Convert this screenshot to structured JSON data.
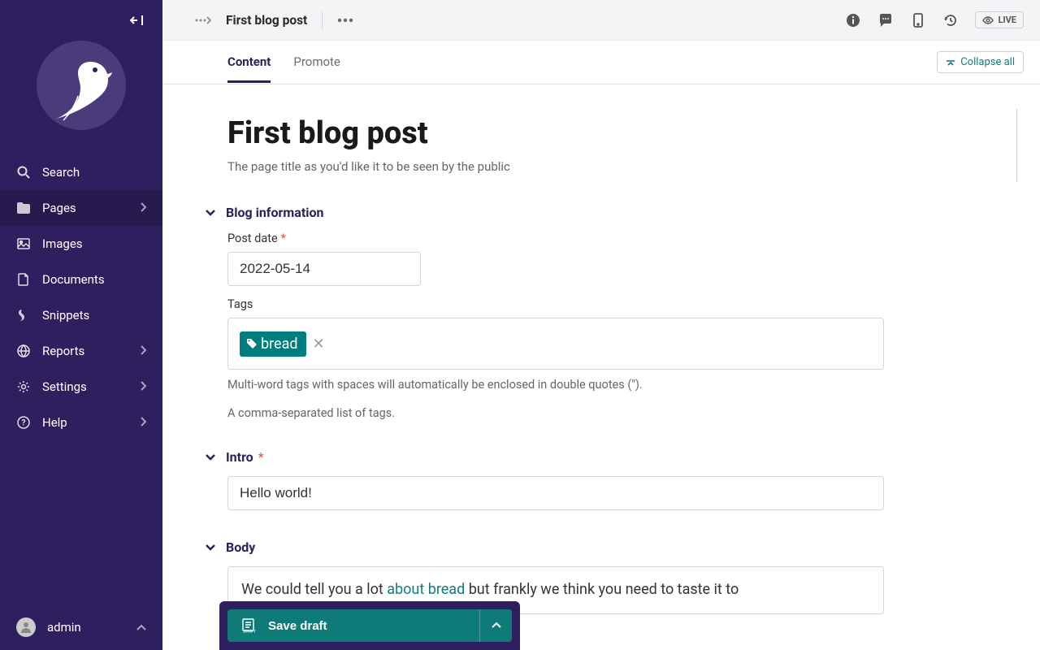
{
  "sidebar": {
    "items": [
      {
        "label": "Search",
        "icon": "search-icon",
        "expandable": false
      },
      {
        "label": "Pages",
        "icon": "folder-icon",
        "expandable": true,
        "active": true
      },
      {
        "label": "Images",
        "icon": "image-icon",
        "expandable": false
      },
      {
        "label": "Documents",
        "icon": "document-icon",
        "expandable": false
      },
      {
        "label": "Snippets",
        "icon": "snippet-icon",
        "expandable": false
      },
      {
        "label": "Reports",
        "icon": "globe-icon",
        "expandable": true
      },
      {
        "label": "Settings",
        "icon": "cog-icon",
        "expandable": true
      },
      {
        "label": "Help",
        "icon": "help-icon",
        "expandable": true
      }
    ],
    "account_label": "admin"
  },
  "topbar": {
    "title": "First blog post",
    "live_label": "LIVE"
  },
  "tabs": {
    "content": "Content",
    "promote": "Promote",
    "collapse_all": "Collapse all"
  },
  "page": {
    "title_value": "First blog post",
    "title_help": "The page title as you'd like it to be seen by the public"
  },
  "blog_info": {
    "section_label": "Blog information",
    "post_date_label": "Post date",
    "post_date_value": "2022-05-14",
    "tags_label": "Tags",
    "tag_value": "bread",
    "tags_hint1": "Multi-word tags with spaces will automatically be enclosed in double quotes (\").",
    "tags_hint2": "A comma-separated list of tags."
  },
  "intro": {
    "section_label": "Intro",
    "value": "Hello world!"
  },
  "body": {
    "section_label": "Body",
    "prefix": "We could tell you a lot ",
    "link_text": "about bread",
    "suffix": " but frankly we think you need to taste it to"
  },
  "footer": {
    "save_label": "Save draft"
  }
}
